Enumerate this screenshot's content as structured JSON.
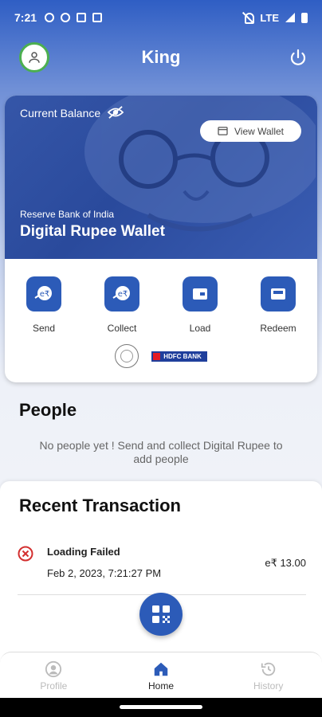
{
  "status_bar": {
    "time": "7:21",
    "network": "LTE"
  },
  "header": {
    "title": "King"
  },
  "wallet": {
    "balance_label": "Current Balance",
    "view_wallet_label": "View Wallet",
    "issuer": "Reserve Bank of India",
    "name": "Digital Rupee Wallet"
  },
  "actions": [
    {
      "label": "Send",
      "icon": "send-icon"
    },
    {
      "label": "Collect",
      "icon": "collect-icon"
    },
    {
      "label": "Load",
      "icon": "load-icon"
    },
    {
      "label": "Redeem",
      "icon": "redeem-icon"
    }
  ],
  "partners": {
    "bank": "HDFC BANK"
  },
  "people": {
    "title": "People",
    "empty_message": "No people yet ! Send and collect Digital Rupee to add people"
  },
  "recent": {
    "title": "Recent Transaction",
    "transactions": [
      {
        "status": "Loading Failed",
        "date": "Feb 2, 2023, 7:21:27 PM",
        "amount": "e₹ 13.00"
      }
    ]
  },
  "bottom_nav": [
    {
      "label": "Profile",
      "icon": "profile-icon",
      "active": false
    },
    {
      "label": "Home",
      "icon": "home-icon",
      "active": true
    },
    {
      "label": "History",
      "icon": "history-icon",
      "active": false
    }
  ],
  "colors": {
    "primary": "#2c5bb8",
    "error": "#d32f2f",
    "avatar_ring": "#4caf50"
  }
}
